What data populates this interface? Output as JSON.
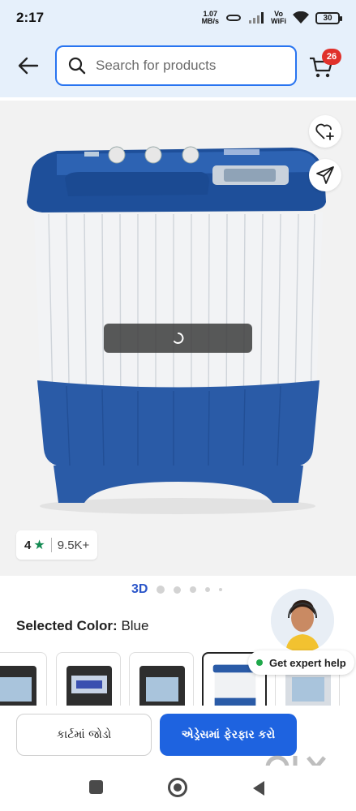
{
  "status_bar": {
    "time": "2:17",
    "net_speed_value": "1.07",
    "net_speed_unit": "MB/s",
    "volte_top": "Vo",
    "volte_bottom": "WiFi",
    "battery": "30"
  },
  "header": {
    "search_placeholder": "Search for products",
    "cart_count": "26"
  },
  "product": {
    "rating_value": "4",
    "rating_count": "9.5K+",
    "gallery_label": "3D",
    "selected_color_label": "Selected Color:",
    "selected_color_value": "Blue"
  },
  "expert": {
    "label": "Get expert help"
  },
  "actions": {
    "add_to_cart": "કાર્ટમાં જોડો",
    "change_address": "એડ્રેસમાં ફેરફાર કરો"
  },
  "icons": {
    "back": "arrow-left-icon",
    "search": "search-icon",
    "cart": "cart-icon",
    "wishlist": "heart-plus-icon",
    "share": "share-icon"
  },
  "colors": {
    "accent": "#2874f0",
    "primary_button": "#1e63e0",
    "badge": "#e0312b",
    "header_bg": "#e6f0fb",
    "star": "#138a52"
  }
}
